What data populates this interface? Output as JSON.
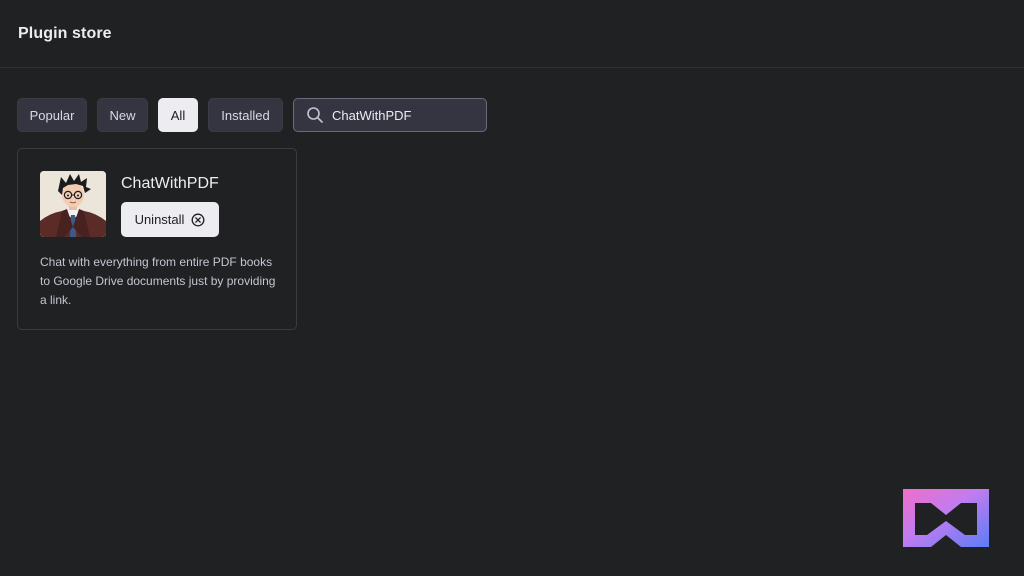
{
  "header": {
    "title": "Plugin store"
  },
  "filters": {
    "popular": "Popular",
    "new": "New",
    "all": "All",
    "installed": "Installed",
    "active": "All"
  },
  "search": {
    "value": "ChatWithPDF",
    "icon": "search-icon"
  },
  "plugin": {
    "name": "ChatWithPDF",
    "uninstall_label": "Uninstall",
    "uninstall_icon": "circle-x-icon",
    "description": "Chat with everything from entire PDF books to Google Drive documents just by providing a link."
  },
  "colors": {
    "background": "#202123",
    "button_bg": "#343541",
    "active_bg": "#ececf1",
    "text": "#ececf1"
  }
}
